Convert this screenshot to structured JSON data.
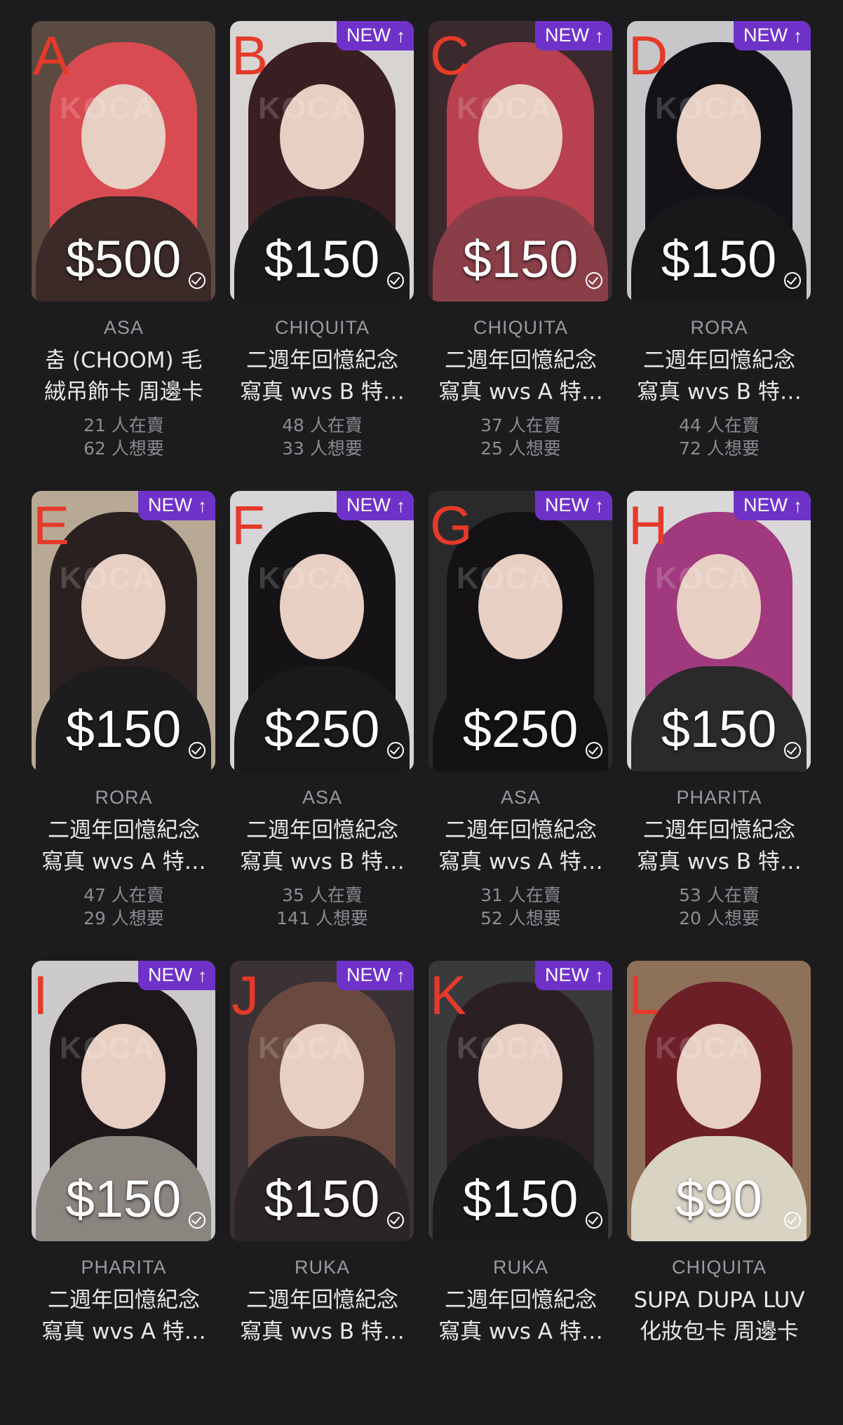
{
  "watermark": "KOCA",
  "badge_text": "NEW",
  "cards": [
    {
      "letter": "A",
      "new": false,
      "price": "$500",
      "artist": "ASA",
      "title": "춤 (CHOOM) 毛\n絨吊飾卡 周邊卡",
      "selling": "21 人在賣",
      "wanting": "62 人想要",
      "hair": "#d94b52",
      "bg": "#5a4a40",
      "top": "#3b2a28"
    },
    {
      "letter": "B",
      "new": true,
      "price": "$150",
      "artist": "CHIQUITA",
      "title": "二週年回憶紀念\n寫真 wvs B 特…",
      "selling": "48 人在賣",
      "wanting": "33 人想要",
      "hair": "#3a1f22",
      "bg": "#d8d4d2",
      "top": "#1b1b1d"
    },
    {
      "letter": "C",
      "new": true,
      "price": "$150",
      "artist": "CHIQUITA",
      "title": "二週年回憶紀念\n寫真 wvs A 特…",
      "selling": "37 人在賣",
      "wanting": "25 人想要",
      "hair": "#b8404f",
      "bg": "#3a2a2d",
      "top": "#8a3e48"
    },
    {
      "letter": "D",
      "new": true,
      "price": "$150",
      "artist": "RORA",
      "title": "二週年回憶紀念\n寫真 wvs B 特…",
      "selling": "44 人在賣",
      "wanting": "72 人想要",
      "hair": "#141216",
      "bg": "#c7c6c8",
      "top": "#18171a"
    },
    {
      "letter": "E",
      "new": true,
      "price": "$150",
      "artist": "RORA",
      "title": "二週年回憶紀念\n寫真 wvs A 特…",
      "selling": "47 人在賣",
      "wanting": "29 人想要",
      "hair": "#2a2020",
      "bg": "#b7a996",
      "top": "#1d1c1e"
    },
    {
      "letter": "F",
      "new": true,
      "price": "$250",
      "artist": "ASA",
      "title": "二週年回憶紀念\n寫真 wvs B 特…",
      "selling": "35 人在賣",
      "wanting": "141 人想要",
      "hair": "#151316",
      "bg": "#d6d4d6",
      "top": "#1a1a1c"
    },
    {
      "letter": "G",
      "new": true,
      "price": "$250",
      "artist": "ASA",
      "title": "二週年回憶紀念\n寫真 wvs A 特…",
      "selling": "31 人在賣",
      "wanting": "52 人想要",
      "hair": "#141215",
      "bg": "#2a2a2c",
      "top": "#131314"
    },
    {
      "letter": "H",
      "new": true,
      "price": "$150",
      "artist": "PHARITA",
      "title": "二週年回憶紀念\n寫真 wvs B 特…",
      "selling": "53 人在賣",
      "wanting": "20 人想要",
      "hair": "#a0397e",
      "bg": "#d9d7d8",
      "top": "#2a2a2a"
    },
    {
      "letter": "I",
      "new": true,
      "price": "$150",
      "artist": "PHARITA",
      "title": "二週年回憶紀念\n寫真 wvs A 特…",
      "selling": "",
      "wanting": "",
      "hair": "#1d1719",
      "bg": "#cbc9c9",
      "top": "#8b8580"
    },
    {
      "letter": "J",
      "new": true,
      "price": "$150",
      "artist": "RUKA",
      "title": "二週年回憶紀念\n寫真 wvs B 特…",
      "selling": "",
      "wanting": "",
      "hair": "#6a4a40",
      "bg": "#3a3234",
      "top": "#2b2527"
    },
    {
      "letter": "K",
      "new": true,
      "price": "$150",
      "artist": "RUKA",
      "title": "二週年回憶紀念\n寫真 wvs A 特…",
      "selling": "",
      "wanting": "",
      "hair": "#2a2023",
      "bg": "#3a3a3c",
      "top": "#1b1b1d"
    },
    {
      "letter": "L",
      "new": false,
      "price": "$90",
      "artist": "CHIQUITA",
      "title": "SUPA DUPA LUV\n化妝包卡 周邊卡",
      "selling": "",
      "wanting": "",
      "hair": "#6d1f28",
      "bg": "#8d7158",
      "top": "#d9d3c4"
    }
  ]
}
